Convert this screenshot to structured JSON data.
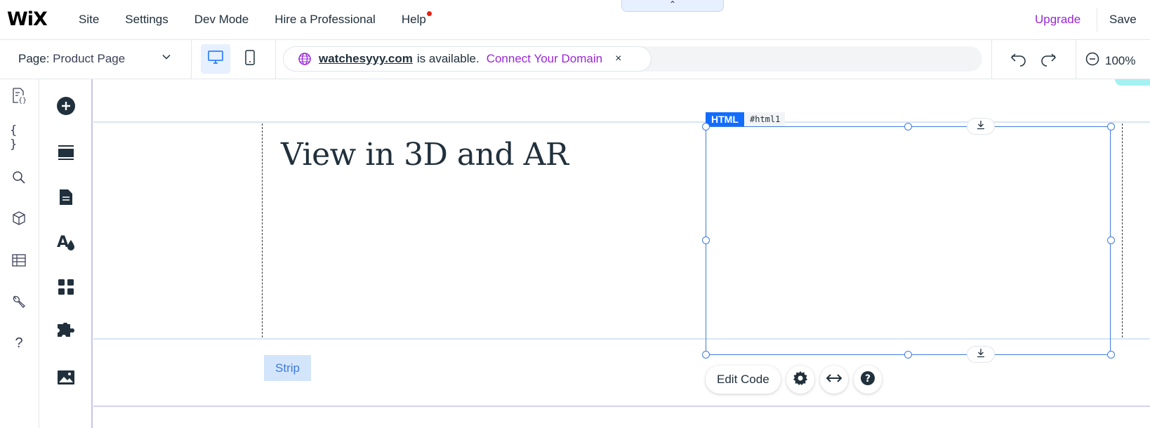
{
  "topbar": {
    "logo": "WiX",
    "menu": [
      "Site",
      "Settings",
      "Dev Mode",
      "Hire a Professional",
      "Help"
    ],
    "collapse_glyph": "⌃",
    "upgrade": "Upgrade",
    "save": "Save"
  },
  "toolbar": {
    "page_prefix": "Page:",
    "page_value": "Product Page",
    "domain_name": "watchesyyy.com",
    "domain_status": "is available.",
    "connect_label": "Connect Your Domain",
    "close_glyph": "×",
    "zoom": "100%"
  },
  "left_rail_icons": [
    "page-code-icon",
    "braces-icon",
    "search-icon",
    "cube-icon",
    "table-icon",
    "wrench-icon",
    "help-icon"
  ],
  "add_rail_icons": [
    "add-icon",
    "sections-icon",
    "pages-icon",
    "design-icon",
    "apps-icon",
    "puzzle-icon",
    "media-icon"
  ],
  "canvas": {
    "heading": "View in 3D and AR",
    "strip_label": "Strip",
    "html_tag": "HTML",
    "html_id": "#html1",
    "edit_code": "Edit Code"
  },
  "colors": {
    "accent": "#116dff",
    "upgrade": "#9a27d5",
    "selection": "#3f7be0",
    "notification": "#e62214"
  }
}
